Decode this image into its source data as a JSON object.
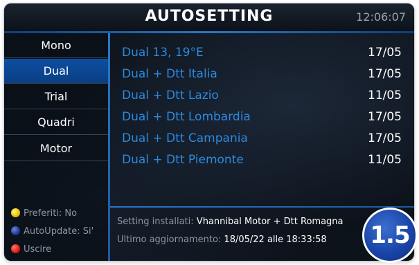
{
  "header": {
    "title": "AUTOSETTING",
    "clock": "12:06:07"
  },
  "sidebar": {
    "items": [
      {
        "label": "Mono"
      },
      {
        "label": "Dual"
      },
      {
        "label": "Trial"
      },
      {
        "label": "Quadri"
      },
      {
        "label": "Motor"
      }
    ],
    "selected": "Dual",
    "legend": [
      {
        "icon": "yellow-button-icon",
        "color": "#e9c400",
        "label": "Preferiti: No"
      },
      {
        "icon": "blue-button-icon",
        "color": "#1f3a9a",
        "label": "AutoUpdate: Si'"
      },
      {
        "icon": "red-button-icon",
        "color": "#e01b10",
        "label": "Uscire"
      }
    ]
  },
  "list": {
    "rows": [
      {
        "name": "Dual 13, 19°E",
        "date": "17/05"
      },
      {
        "name": "Dual + Dtt Italia",
        "date": "17/05"
      },
      {
        "name": "Dual + Dtt Lazio",
        "date": "11/05"
      },
      {
        "name": "Dual + Dtt Lombardia",
        "date": "17/05"
      },
      {
        "name": "Dual + Dtt Campania",
        "date": "17/05"
      },
      {
        "name": "Dual + Dtt Piemonte",
        "date": "11/05"
      }
    ]
  },
  "info": {
    "installed_label": "Setting installati:",
    "installed_value": "Vhannibal Motor + Dtt Romagna",
    "updated_label": "Ultimo aggiornamento:",
    "updated_value": "18/05/22 alle 18:33:58"
  },
  "version": "1.5",
  "colors": {
    "accent": "#2a78c8",
    "selected_bg": "#0d4ea0",
    "row_text": "#2a8ae0"
  }
}
